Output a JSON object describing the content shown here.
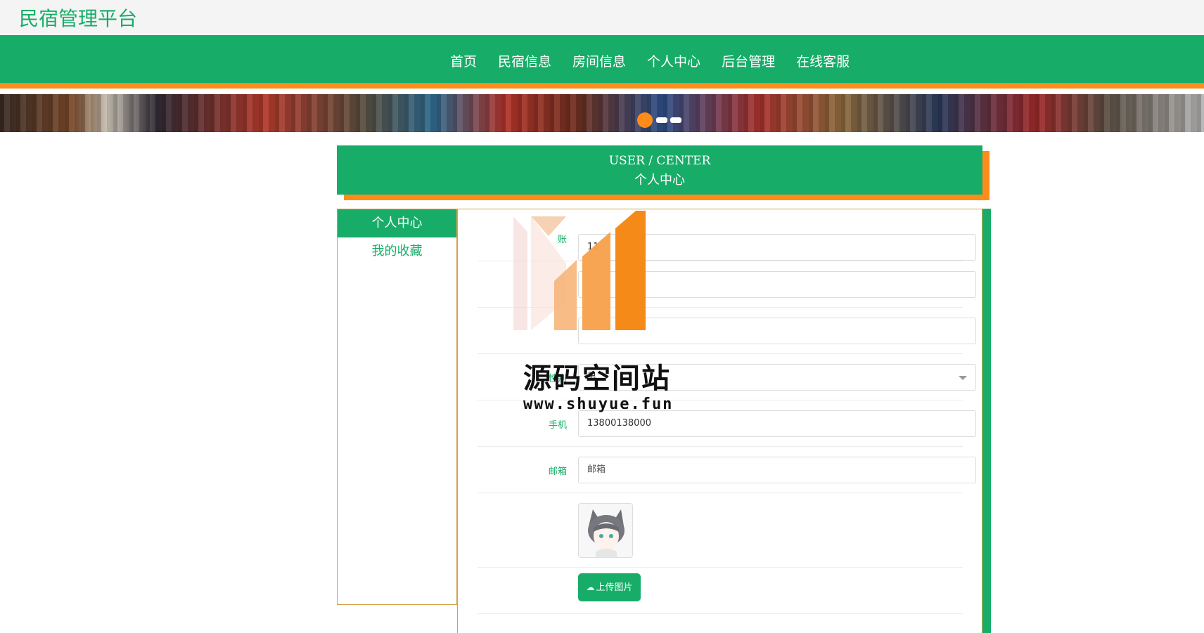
{
  "app": {
    "title": "民宿管理平台"
  },
  "nav": {
    "items": [
      "首页",
      "民宿信息",
      "房间信息",
      "个人中心",
      "后台管理",
      "在线客服"
    ]
  },
  "section": {
    "en_title": "USER / CENTER",
    "cn_title": "个人中心"
  },
  "sidebar": {
    "items": [
      "个人中心",
      "我的收藏"
    ],
    "active": "个人中心"
  },
  "form": {
    "account": {
      "label": "账",
      "value": "11"
    },
    "field2": {
      "label": "",
      "value": ""
    },
    "field3": {
      "label": "",
      "value": ""
    },
    "gender": {
      "label": "性别",
      "value": "男"
    },
    "phone": {
      "label": "手机",
      "value": "13800138000"
    },
    "email": {
      "label": "邮箱",
      "placeholder": "邮箱"
    },
    "upload": {
      "label": "上传图片"
    }
  },
  "watermark": {
    "name": "源码空间站",
    "url": "www.shuyue.fun"
  },
  "colors": {
    "primary": "#17ad68",
    "accent": "#ff8c1a"
  },
  "icons": {
    "upload": "cloud-upload-icon",
    "select": "chevron-down-icon"
  }
}
